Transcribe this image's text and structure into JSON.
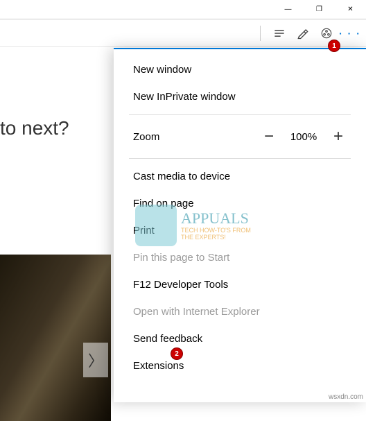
{
  "window_controls": {
    "min": "—",
    "max": "❐",
    "close": "✕"
  },
  "page": {
    "headline_fragment": "to next?"
  },
  "menu": {
    "new_window": "New window",
    "new_inprivate": "New InPrivate window",
    "zoom_label": "Zoom",
    "zoom_value": "100%",
    "cast": "Cast media to device",
    "find": "Find on page",
    "print": "Print",
    "pin": "Pin this page to Start",
    "devtools": "F12 Developer Tools",
    "ie": "Open with Internet Explorer",
    "feedback": "Send feedback",
    "extensions": "Extensions"
  },
  "callouts": {
    "one": "1",
    "two": "2"
  },
  "watermark": {
    "brand": "APPUALS",
    "tagline1": "TECH HOW-TO'S FROM",
    "tagline2": "THE EXPERTS!"
  },
  "source_mark": "wsxdn.com"
}
